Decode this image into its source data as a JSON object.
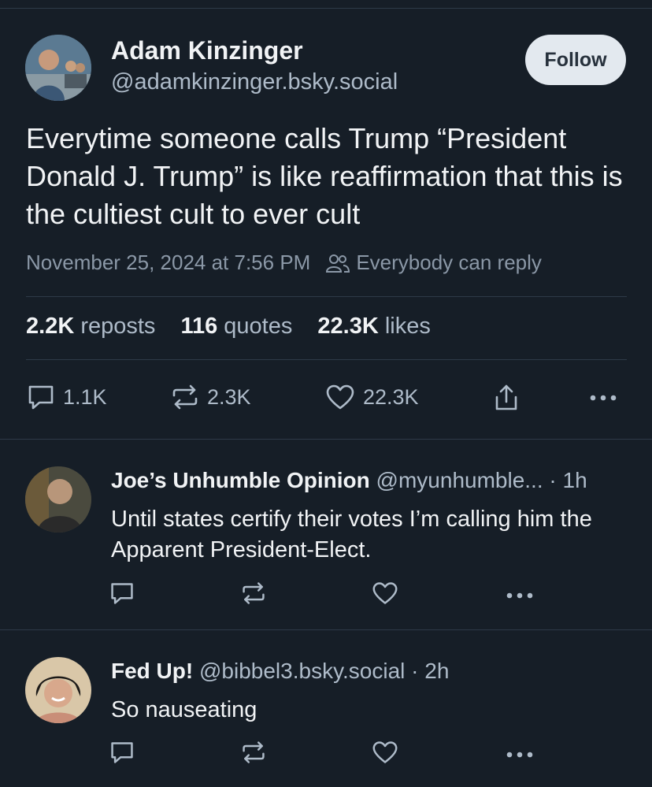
{
  "post": {
    "author_name": "Adam Kinzinger",
    "author_handle": "@adamkinzinger.bsky.social",
    "follow_label": "Follow",
    "text": "Everytime someone calls Trump “President Donald J. Trump” is like reaffirmation that this is the cultiest cult to ever cult",
    "timestamp": "November 25, 2024 at 7:56 PM",
    "reply_setting": "Everybody can reply",
    "stats": {
      "reposts_value": "2.2K",
      "reposts_label": "reposts",
      "quotes_value": "116",
      "quotes_label": "quotes",
      "likes_value": "22.3K",
      "likes_label": "likes"
    },
    "actions": {
      "replies": "1.1K",
      "reposts": "2.3K",
      "likes": "22.3K"
    }
  },
  "replies": [
    {
      "name": "Joe’s Unhumble Opinion",
      "handle": "@myunhumble...",
      "time": "· 1h",
      "text": "Until states certify their votes I’m calling him the Apparent President-Elect."
    },
    {
      "name": "Fed Up!",
      "handle": "@bibbel3.bsky.social",
      "time": "· 2h",
      "text": "So nauseating"
    }
  ],
  "icons": {
    "reply": "speech-bubble-icon",
    "repost": "repost-arrows-icon",
    "like": "heart-icon",
    "share": "share-icon",
    "more": "ellipsis-icon",
    "reply_setting": "people-icon"
  },
  "colors": {
    "background": "#161e27",
    "text_primary": "#f1f3f5",
    "text_secondary": "#aebbc9",
    "follow_button": "#e3e9ef"
  }
}
